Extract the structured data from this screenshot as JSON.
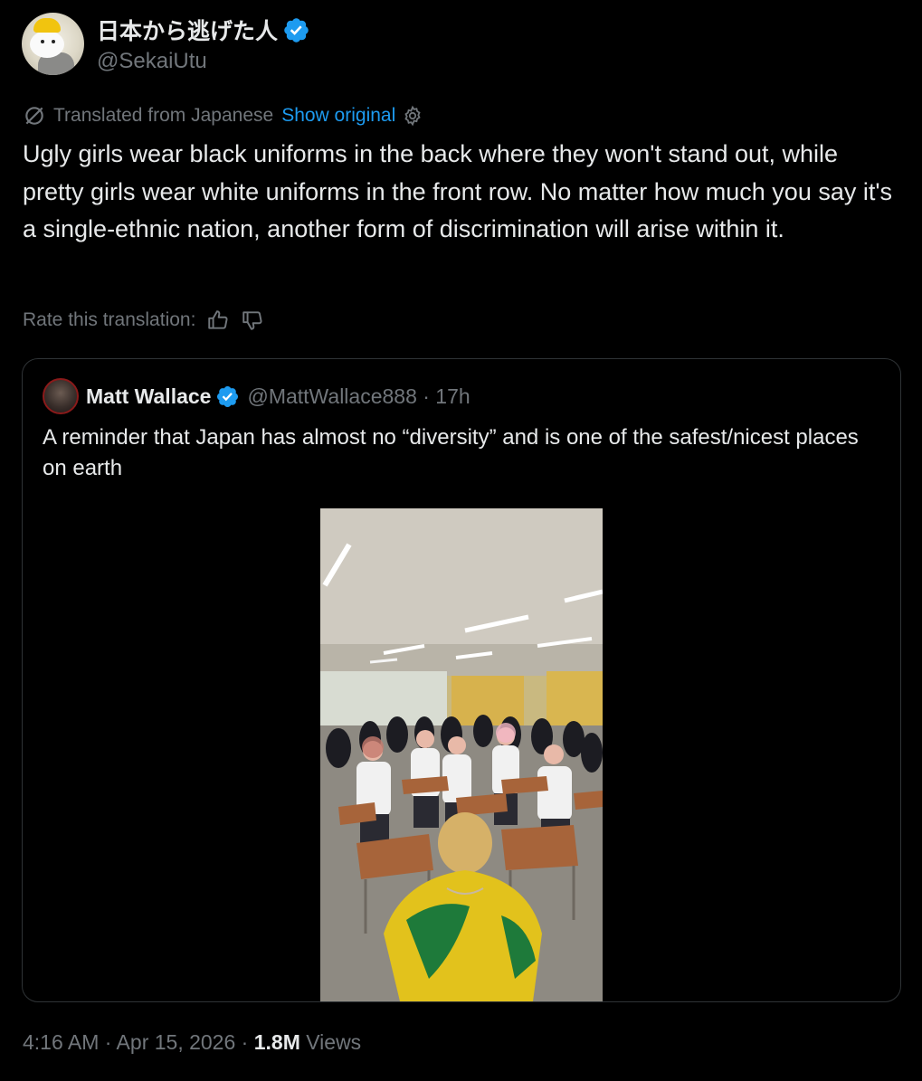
{
  "author": {
    "display_name": "日本から逃げた人",
    "handle": "@SekaiUtu",
    "verified": true
  },
  "translation": {
    "label": "Translated from Japanese",
    "show_original": "Show original",
    "icon": "no-translate-icon"
  },
  "tweet": {
    "text": "Ugly girls wear black uniforms in the back where they won't stand out, while pretty girls wear white uniforms in the front row. No matter how much you say it's a single-ethnic nation, another form of discrimination will arise within it."
  },
  "rate": {
    "label": "Rate this translation:"
  },
  "quoted_tweet": {
    "display_name": "Matt Wallace",
    "handle_time": "@MattWallace888 · 17h",
    "text": "A reminder that Japan has almost no “diversity” and is one of the safest/nicest places on earth",
    "media": "classroom-video-thumbnail"
  },
  "footer": {
    "time_date": "4:16 AM · Apr 15, 2026 · ",
    "views_count": "1.8M",
    "views_label": " Views"
  },
  "colors": {
    "background": "#000000",
    "text": "#e7e9ea",
    "muted": "#71767b",
    "link": "#1d9bf0",
    "verified": "#1d9bf0",
    "border": "#2f3336"
  }
}
